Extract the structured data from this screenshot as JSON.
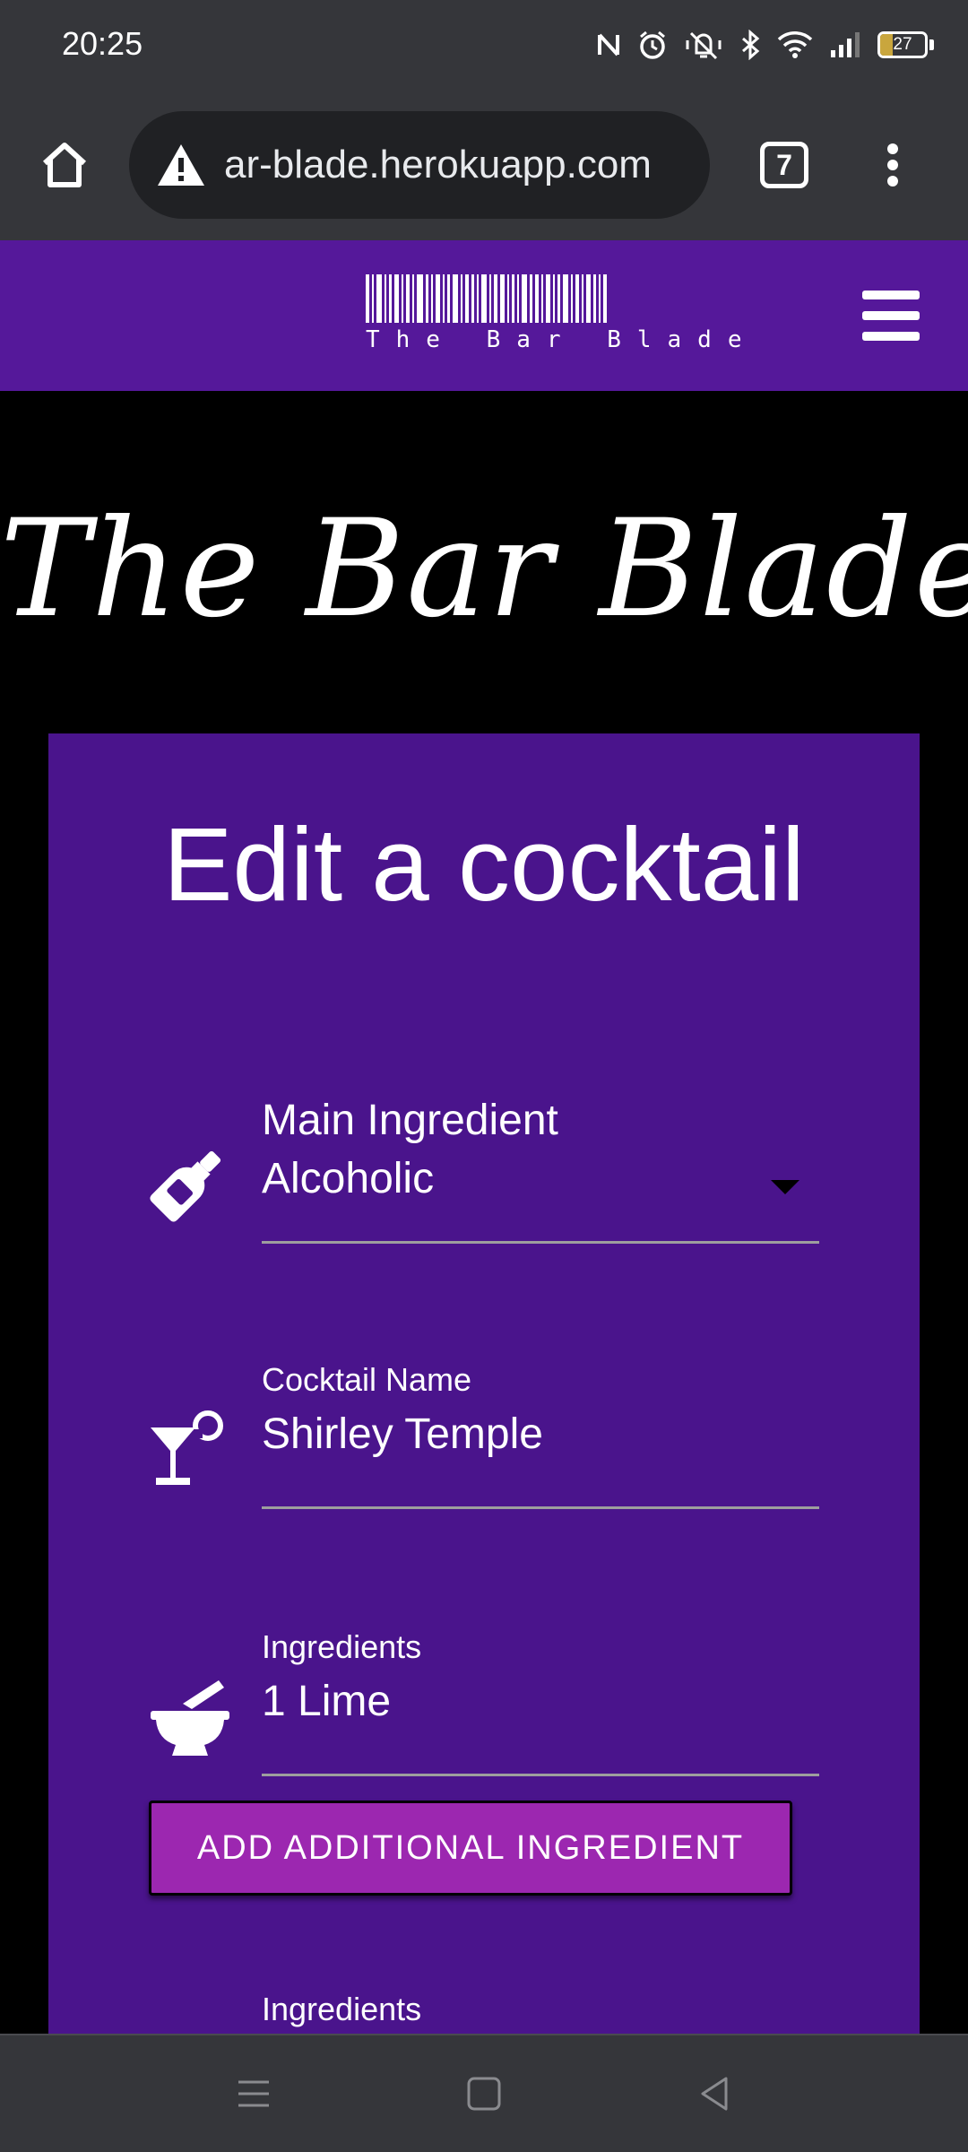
{
  "status_bar": {
    "time": "20:25",
    "battery_level": "27",
    "icons": [
      "nfc-icon",
      "alarm-icon",
      "vibrate-off-icon",
      "bluetooth-icon",
      "wifi-icon",
      "signal-icon",
      "battery-icon"
    ]
  },
  "browser": {
    "url": "ar-blade.herokuapp.com",
    "tab_count": "7",
    "icons": [
      "home-icon",
      "warning-icon",
      "more-vert-icon"
    ]
  },
  "navbar": {
    "brand_text": "The Bar Blade",
    "icons": [
      "barcode-logo",
      "hamburger-menu-icon"
    ]
  },
  "hero": {
    "title": "The Bar Blade"
  },
  "form": {
    "title": "Edit a cocktail",
    "main_ingredient": {
      "label": "Main Ingredient",
      "value": "Alcoholic",
      "icon": "bottle-icon"
    },
    "cocktail_name": {
      "label": "Cocktail Name",
      "value": "Shirley Temple",
      "icon": "cocktail-glass-icon"
    },
    "ingredients": [
      {
        "label": "Ingredients",
        "value": "1 Lime",
        "icon": "mortar-pestle-icon"
      },
      {
        "label": "Ingredients",
        "value": ""
      }
    ],
    "add_button": "ADD ADDITIONAL INGREDIENT"
  },
  "colors": {
    "navbar": "#55189a",
    "card": "#4a148c",
    "button": "#9c27b0",
    "chrome": "#35363a"
  }
}
